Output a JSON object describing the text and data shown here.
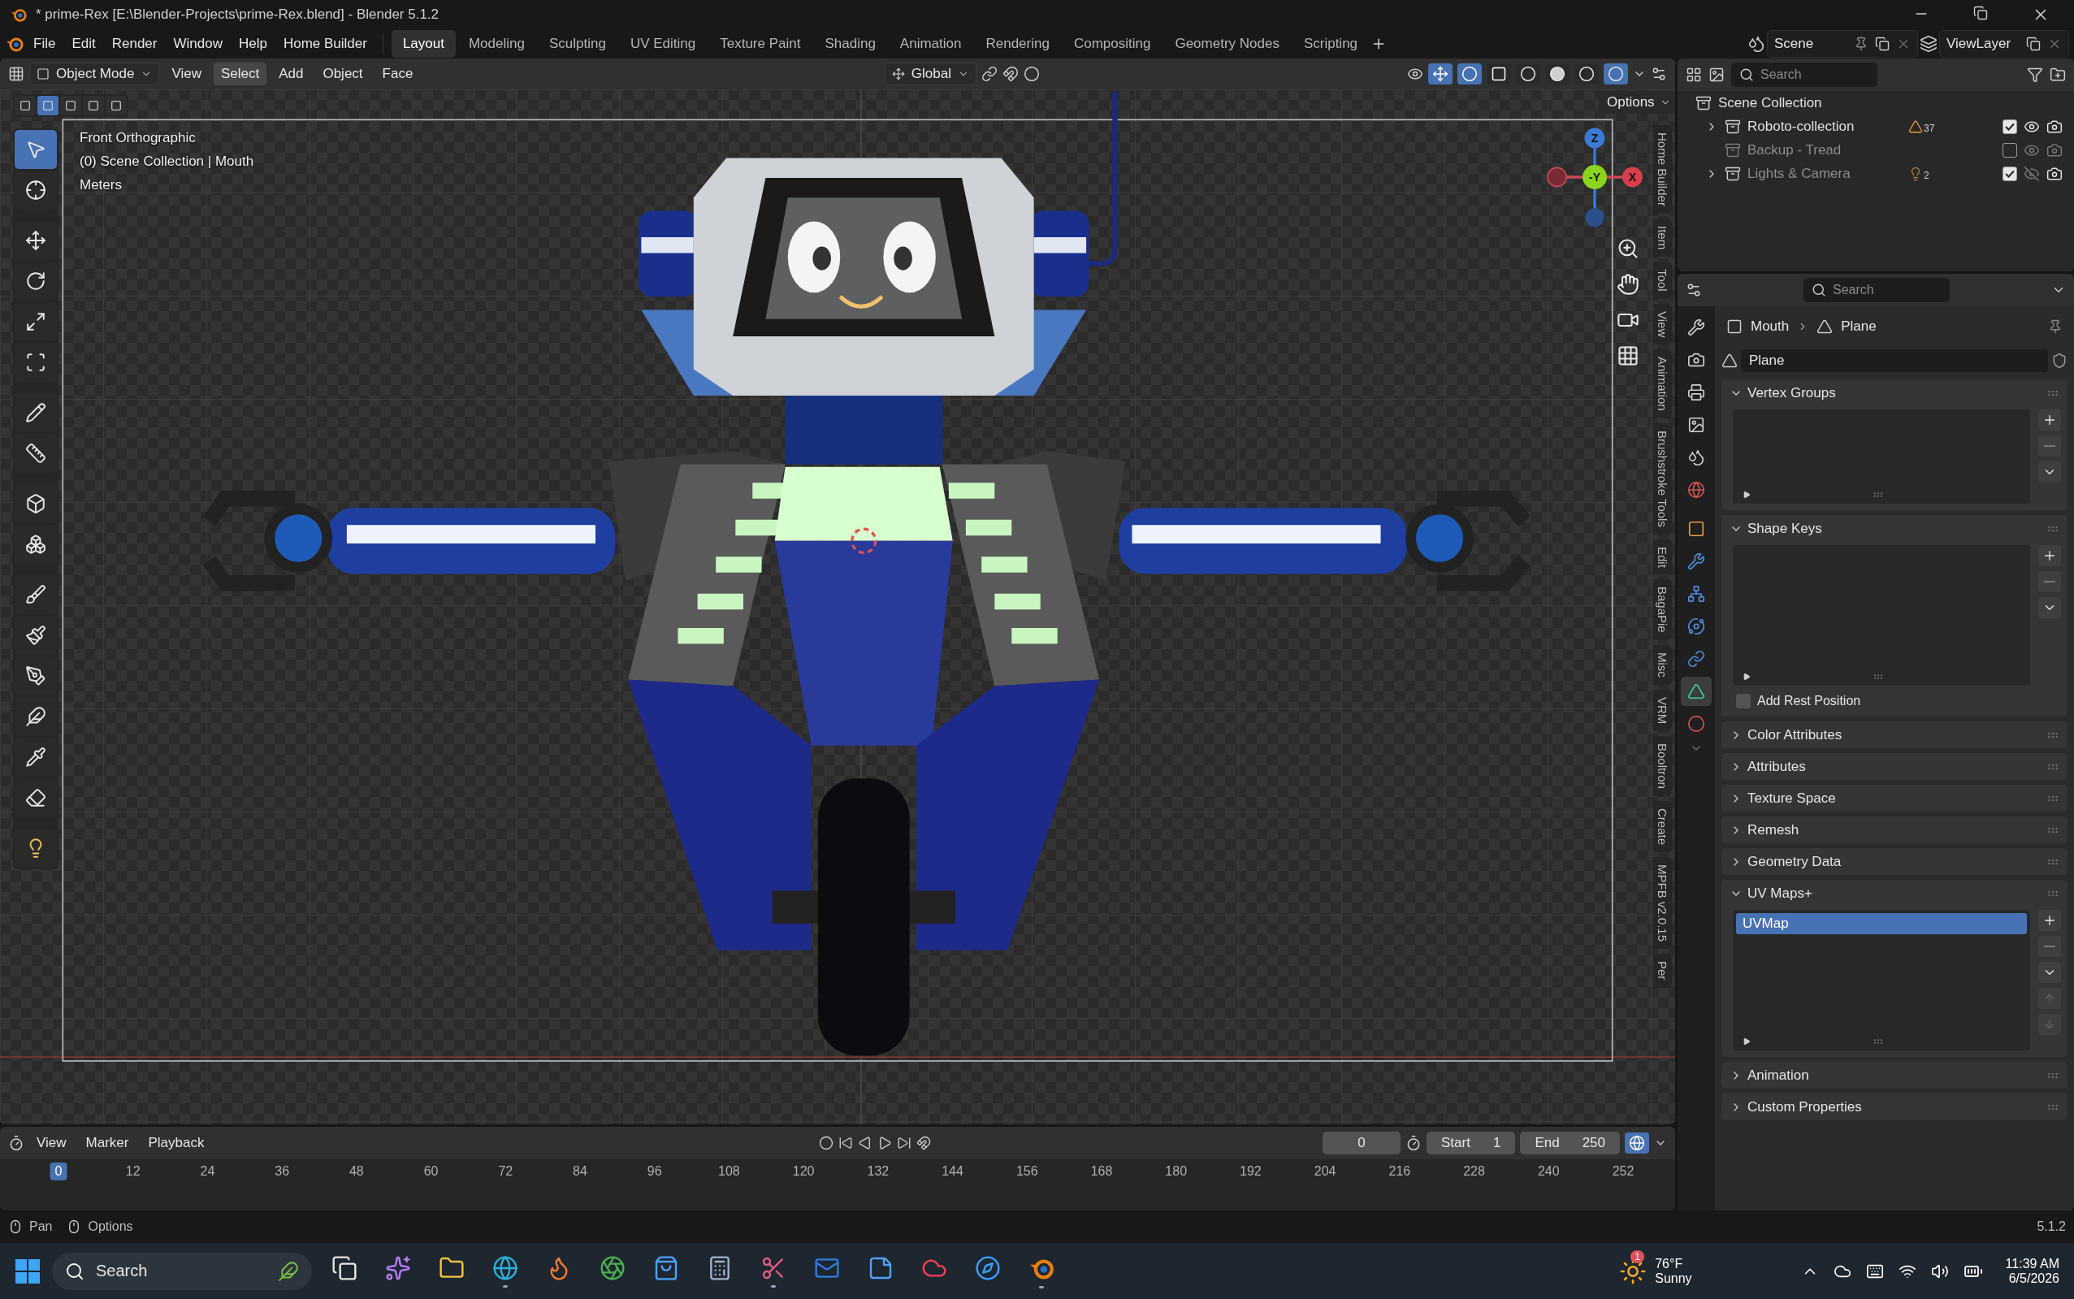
{
  "window": {
    "title": "* prime-Rex [E:\\Blender-Projects\\prime-Rex.blend] - Blender 5.1.2"
  },
  "menu": [
    "File",
    "Edit",
    "Render",
    "Window",
    "Help",
    "Home Builder"
  ],
  "workspaces": [
    {
      "label": "Layout",
      "selected": true
    },
    {
      "label": "Modeling",
      "selected": false
    },
    {
      "label": "Sculpting",
      "selected": false
    },
    {
      "label": "UV Editing",
      "selected": false
    },
    {
      "label": "Texture Paint",
      "selected": false
    },
    {
      "label": "Shading",
      "selected": false
    },
    {
      "label": "Animation",
      "selected": false
    },
    {
      "label": "Rendering",
      "selected": false
    },
    {
      "label": "Compositing",
      "selected": false
    },
    {
      "label": "Geometry Nodes",
      "selected": false
    },
    {
      "label": "Scripting",
      "selected": false
    }
  ],
  "scene": {
    "name": "Scene"
  },
  "view_layer": {
    "name": "ViewLayer"
  },
  "viewport": {
    "mode": "Object Mode",
    "menus": [
      {
        "label": "View",
        "selected": false
      },
      {
        "label": "Select",
        "selected": true
      },
      {
        "label": "Add",
        "selected": false
      },
      {
        "label": "Object",
        "selected": false
      },
      {
        "label": "Face",
        "selected": false
      }
    ],
    "orientation": "Global",
    "options": "Options",
    "select_modes": [
      {
        "selected": false
      },
      {
        "selected": true
      },
      {
        "selected": false
      },
      {
        "selected": false
      },
      {
        "selected": false
      }
    ],
    "toggles": [
      {
        "on": true
      },
      {
        "on": true
      },
      {
        "on": false
      }
    ],
    "shading": [
      {
        "selected": false
      },
      {
        "selected": false
      },
      {
        "selected": false
      },
      {
        "selected": true
      }
    ],
    "overlay_text": [
      "Front Orthographic",
      "(0) Scene Collection | Mouth",
      "Meters"
    ],
    "tools": [
      {
        "selected": true
      },
      {
        "selected": false
      },
      {
        "selected": false
      },
      {
        "selected": false
      },
      {
        "selected": false
      },
      {
        "selected": false
      },
      {
        "selected": false
      },
      {
        "selected": false
      },
      {
        "selected": false
      },
      {
        "selected": false
      },
      {
        "selected": false
      },
      {
        "selected": false
      },
      {
        "selected": false
      },
      {
        "selected": false
      },
      {
        "selected": false
      },
      {
        "selected": false
      },
      {
        "selected": false
      }
    ],
    "gizmo": [
      "Z",
      "-Y",
      "X"
    ],
    "side_tabs": [
      "Home Builder",
      "Item",
      "Tool",
      "View",
      "Animation",
      "Brushstroke Tools",
      "Edit",
      "BagaPie",
      "Misc",
      "VRM",
      "Booltron",
      "Create",
      "MPFB v2.0.15",
      "Per"
    ]
  },
  "outliner": {
    "search_placeholder": "Search",
    "root": "Scene Collection",
    "collections": [
      {
        "name": "Roboto-collection",
        "expandable": true,
        "disabled": false,
        "badge": "37",
        "checked": true,
        "visible": true
      },
      {
        "name": "Backup - Tread",
        "expandable": false,
        "disabled": true,
        "checked": false,
        "visible": true
      },
      {
        "name": "Lights & Camera",
        "expandable": true,
        "disabled": false,
        "badge": "2",
        "checked": true,
        "visible": false
      }
    ]
  },
  "properties": {
    "search_placeholder": "Search",
    "tabs": [
      {
        "selected": false
      },
      {
        "selected": false
      },
      {
        "selected": false
      },
      {
        "selected": false
      },
      {
        "selected": false
      },
      {
        "selected": false
      },
      {
        "selected": false
      },
      {
        "selected": false
      },
      {
        "selected": false
      },
      {
        "selected": false
      },
      {
        "selected": false
      },
      {
        "selected": true
      },
      {
        "selected": false
      }
    ],
    "breadcrumb": [
      "Mouth",
      "Plane"
    ],
    "data_name": "Plane",
    "panels": [
      {
        "title": "Vertex Groups",
        "expanded": true
      },
      {
        "title": "Shape Keys",
        "expanded": true,
        "option": {
          "label": "Add Rest Position",
          "checked": false
        }
      },
      {
        "title": "Color Attributes",
        "expanded": false
      },
      {
        "title": "Attributes",
        "expanded": false
      },
      {
        "title": "Texture Space",
        "expanded": false
      },
      {
        "title": "Remesh",
        "expanded": false
      },
      {
        "title": "Geometry Data",
        "expanded": false
      },
      {
        "title": "UV Maps+",
        "expanded": true,
        "items": [
          {
            "name": "UVMap",
            "selected": true
          }
        ]
      },
      {
        "title": "Animation",
        "expanded": false
      },
      {
        "title": "Custom Properties",
        "expanded": false
      }
    ]
  },
  "timeline": {
    "menus": [
      "View",
      "Marker",
      "Playback"
    ],
    "current_frame": "0",
    "start_label": "Start",
    "start": "1",
    "end_label": "End",
    "end": "250",
    "ticks": [
      {
        "label": "0",
        "selected": true
      },
      {
        "label": "12",
        "selected": false
      },
      {
        "label": "24",
        "selected": false
      },
      {
        "label": "36",
        "selected": false
      },
      {
        "label": "48",
        "selected": false
      },
      {
        "label": "60",
        "selected": false
      },
      {
        "label": "72",
        "selected": false
      },
      {
        "label": "84",
        "selected": false
      },
      {
        "label": "96",
        "selected": false
      },
      {
        "label": "108",
        "selected": false
      },
      {
        "label": "120",
        "selected": false
      },
      {
        "label": "132",
        "selected": false
      },
      {
        "label": "144",
        "selected": false
      },
      {
        "label": "156",
        "selected": false
      },
      {
        "label": "168",
        "selected": false
      },
      {
        "label": "180",
        "selected": false
      },
      {
        "label": "192",
        "selected": false
      },
      {
        "label": "204",
        "selected": false
      },
      {
        "label": "216",
        "selected": false
      },
      {
        "label": "228",
        "selected": false
      },
      {
        "label": "240",
        "selected": false
      },
      {
        "label": "252",
        "selected": false
      }
    ]
  },
  "status": {
    "hints": [
      "Pan",
      "Options"
    ],
    "version": "5.1.2"
  },
  "taskbar": {
    "search_placeholder": "Search",
    "apps": [
      {
        "running": false
      },
      {
        "running": false
      },
      {
        "running": false
      },
      {
        "running": true
      },
      {
        "running": false
      },
      {
        "running": false
      },
      {
        "running": false
      },
      {
        "running": false
      },
      {
        "running": true
      },
      {
        "running": false
      },
      {
        "running": false
      },
      {
        "running": false
      },
      {
        "running": false
      },
      {
        "running": true
      }
    ],
    "weather": {
      "badge": "1",
      "temp": "76°F",
      "condition": "Sunny"
    },
    "time": "11:39 AM",
    "date": "6/5/2026"
  }
}
